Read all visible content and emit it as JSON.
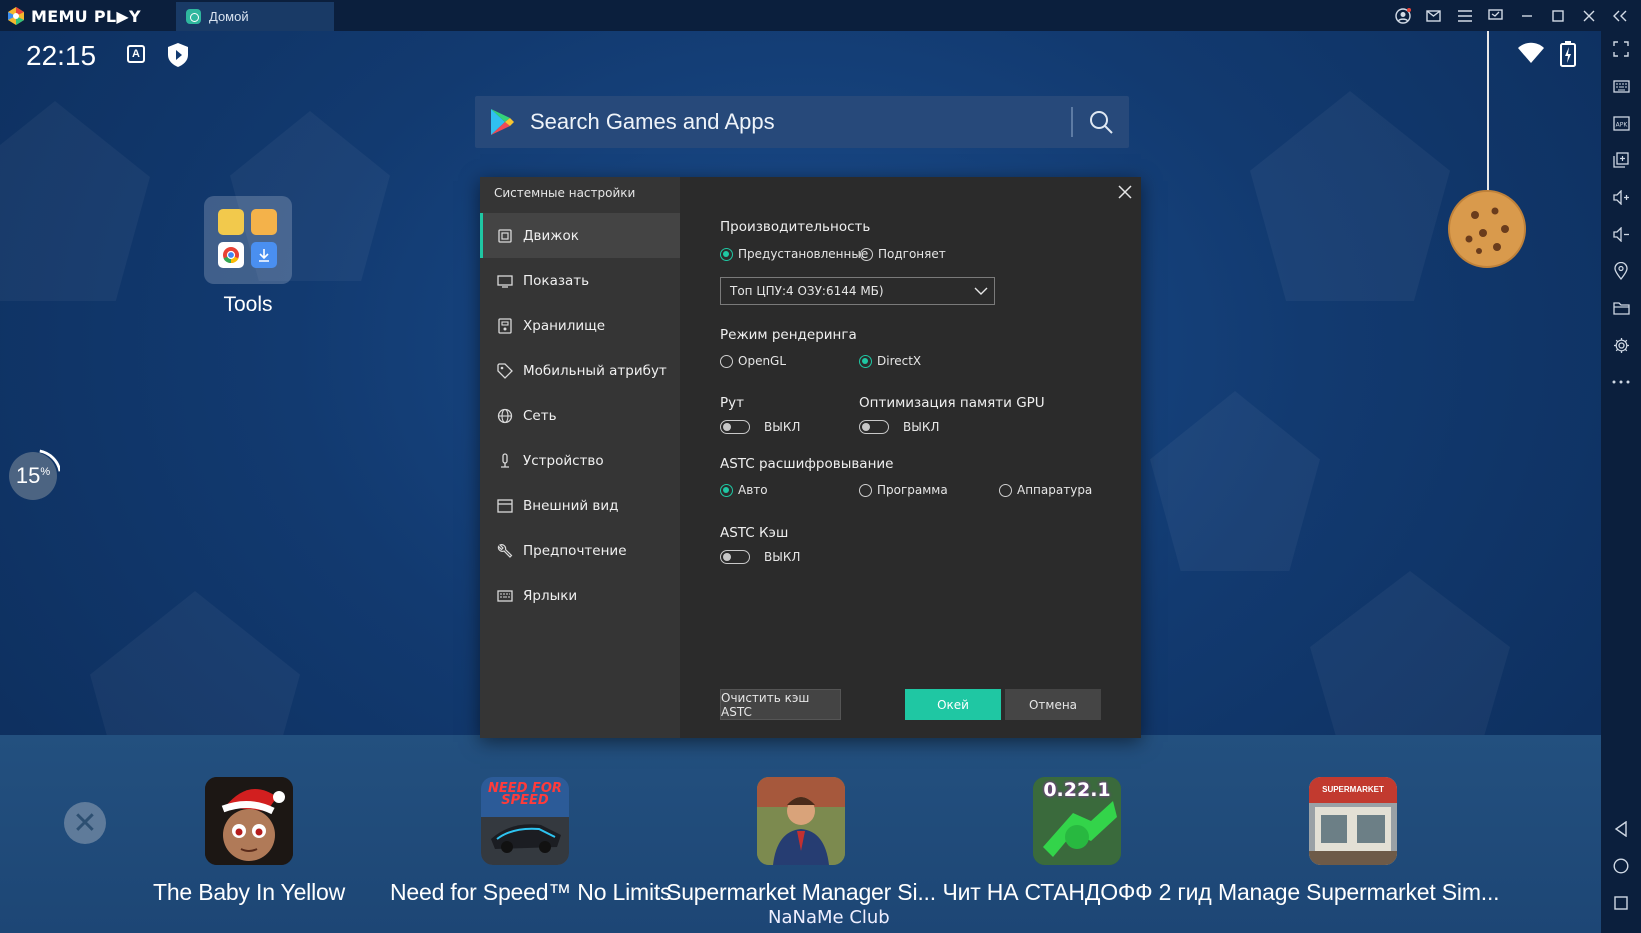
{
  "titlebar": {
    "brand": "MEMU PL▶Y",
    "tab_label": "Домой"
  },
  "status": {
    "time": "22:15",
    "keyboard_indicator": "A"
  },
  "search": {
    "placeholder": "Search Games and Apps"
  },
  "desktop": {
    "folder_label": "Tools",
    "progress_value": "15",
    "progress_unit": "%"
  },
  "dialog": {
    "title": "Системные настройки",
    "menu": [
      {
        "label": "Движок",
        "icon": "chip-icon",
        "active": true
      },
      {
        "label": "Показать",
        "icon": "monitor-icon"
      },
      {
        "label": "Хранилище",
        "icon": "storage-icon"
      },
      {
        "label": "Мобильный атрибут",
        "icon": "tag-icon"
      },
      {
        "label": "Сеть",
        "icon": "globe-icon"
      },
      {
        "label": "Устройство",
        "icon": "microphone-icon"
      },
      {
        "label": "Внешний вид",
        "icon": "window-icon"
      },
      {
        "label": "Предпочтение",
        "icon": "wrench-icon"
      },
      {
        "label": "Ярлыки",
        "icon": "keyboard-icon"
      }
    ],
    "performance": {
      "label": "Производительность",
      "option_preset": "Предустановленные",
      "option_custom": "Подгоняет",
      "selected": "Предустановленные",
      "select_value": "Топ ЦПУ:4 ОЗУ:6144 МБ)"
    },
    "render": {
      "label": "Режим рендеринга",
      "option_opengl": "OpenGL",
      "option_directx": "DirectX",
      "selected": "DirectX"
    },
    "root": {
      "label": "Рут",
      "state": "ВЫКЛ"
    },
    "gpu_memory": {
      "label": "Оптимизация памяти GPU",
      "state": "ВЫКЛ"
    },
    "astc_decode": {
      "label": "ASTC расшифровывание",
      "option_auto": "Авто",
      "option_software": "Программа",
      "option_hardware": "Аппаратура",
      "selected": "Авто"
    },
    "astc_cache": {
      "label": "ASTC Кэш",
      "state": "ВЫКЛ"
    },
    "buttons": {
      "clear_cache": "Очистить кэш ASTC",
      "ok": "Окей",
      "cancel": "Отмена"
    }
  },
  "dock": {
    "apps": [
      {
        "name": "The Baby In Yellow"
      },
      {
        "name": "Need for Speed™ No Limits"
      },
      {
        "name": "Supermarket Manager Si..."
      },
      {
        "name": "Чит НА СТАНДОФФ 2 гид"
      },
      {
        "name": "Manage Supermarket Sim..."
      }
    ],
    "nfs_icon_text": "NEED FOR SPEED",
    "standoff_icon_text": "0.22.1",
    "supermarket_icon_text": "SUPERMARKET"
  },
  "watermark": "NaNaMe Club",
  "colors": {
    "accent": "#1fc7a3",
    "titlebar": "#0b1f3d",
    "dialog_bg": "#2b2b2b",
    "dialog_sidebar": "#353535"
  }
}
